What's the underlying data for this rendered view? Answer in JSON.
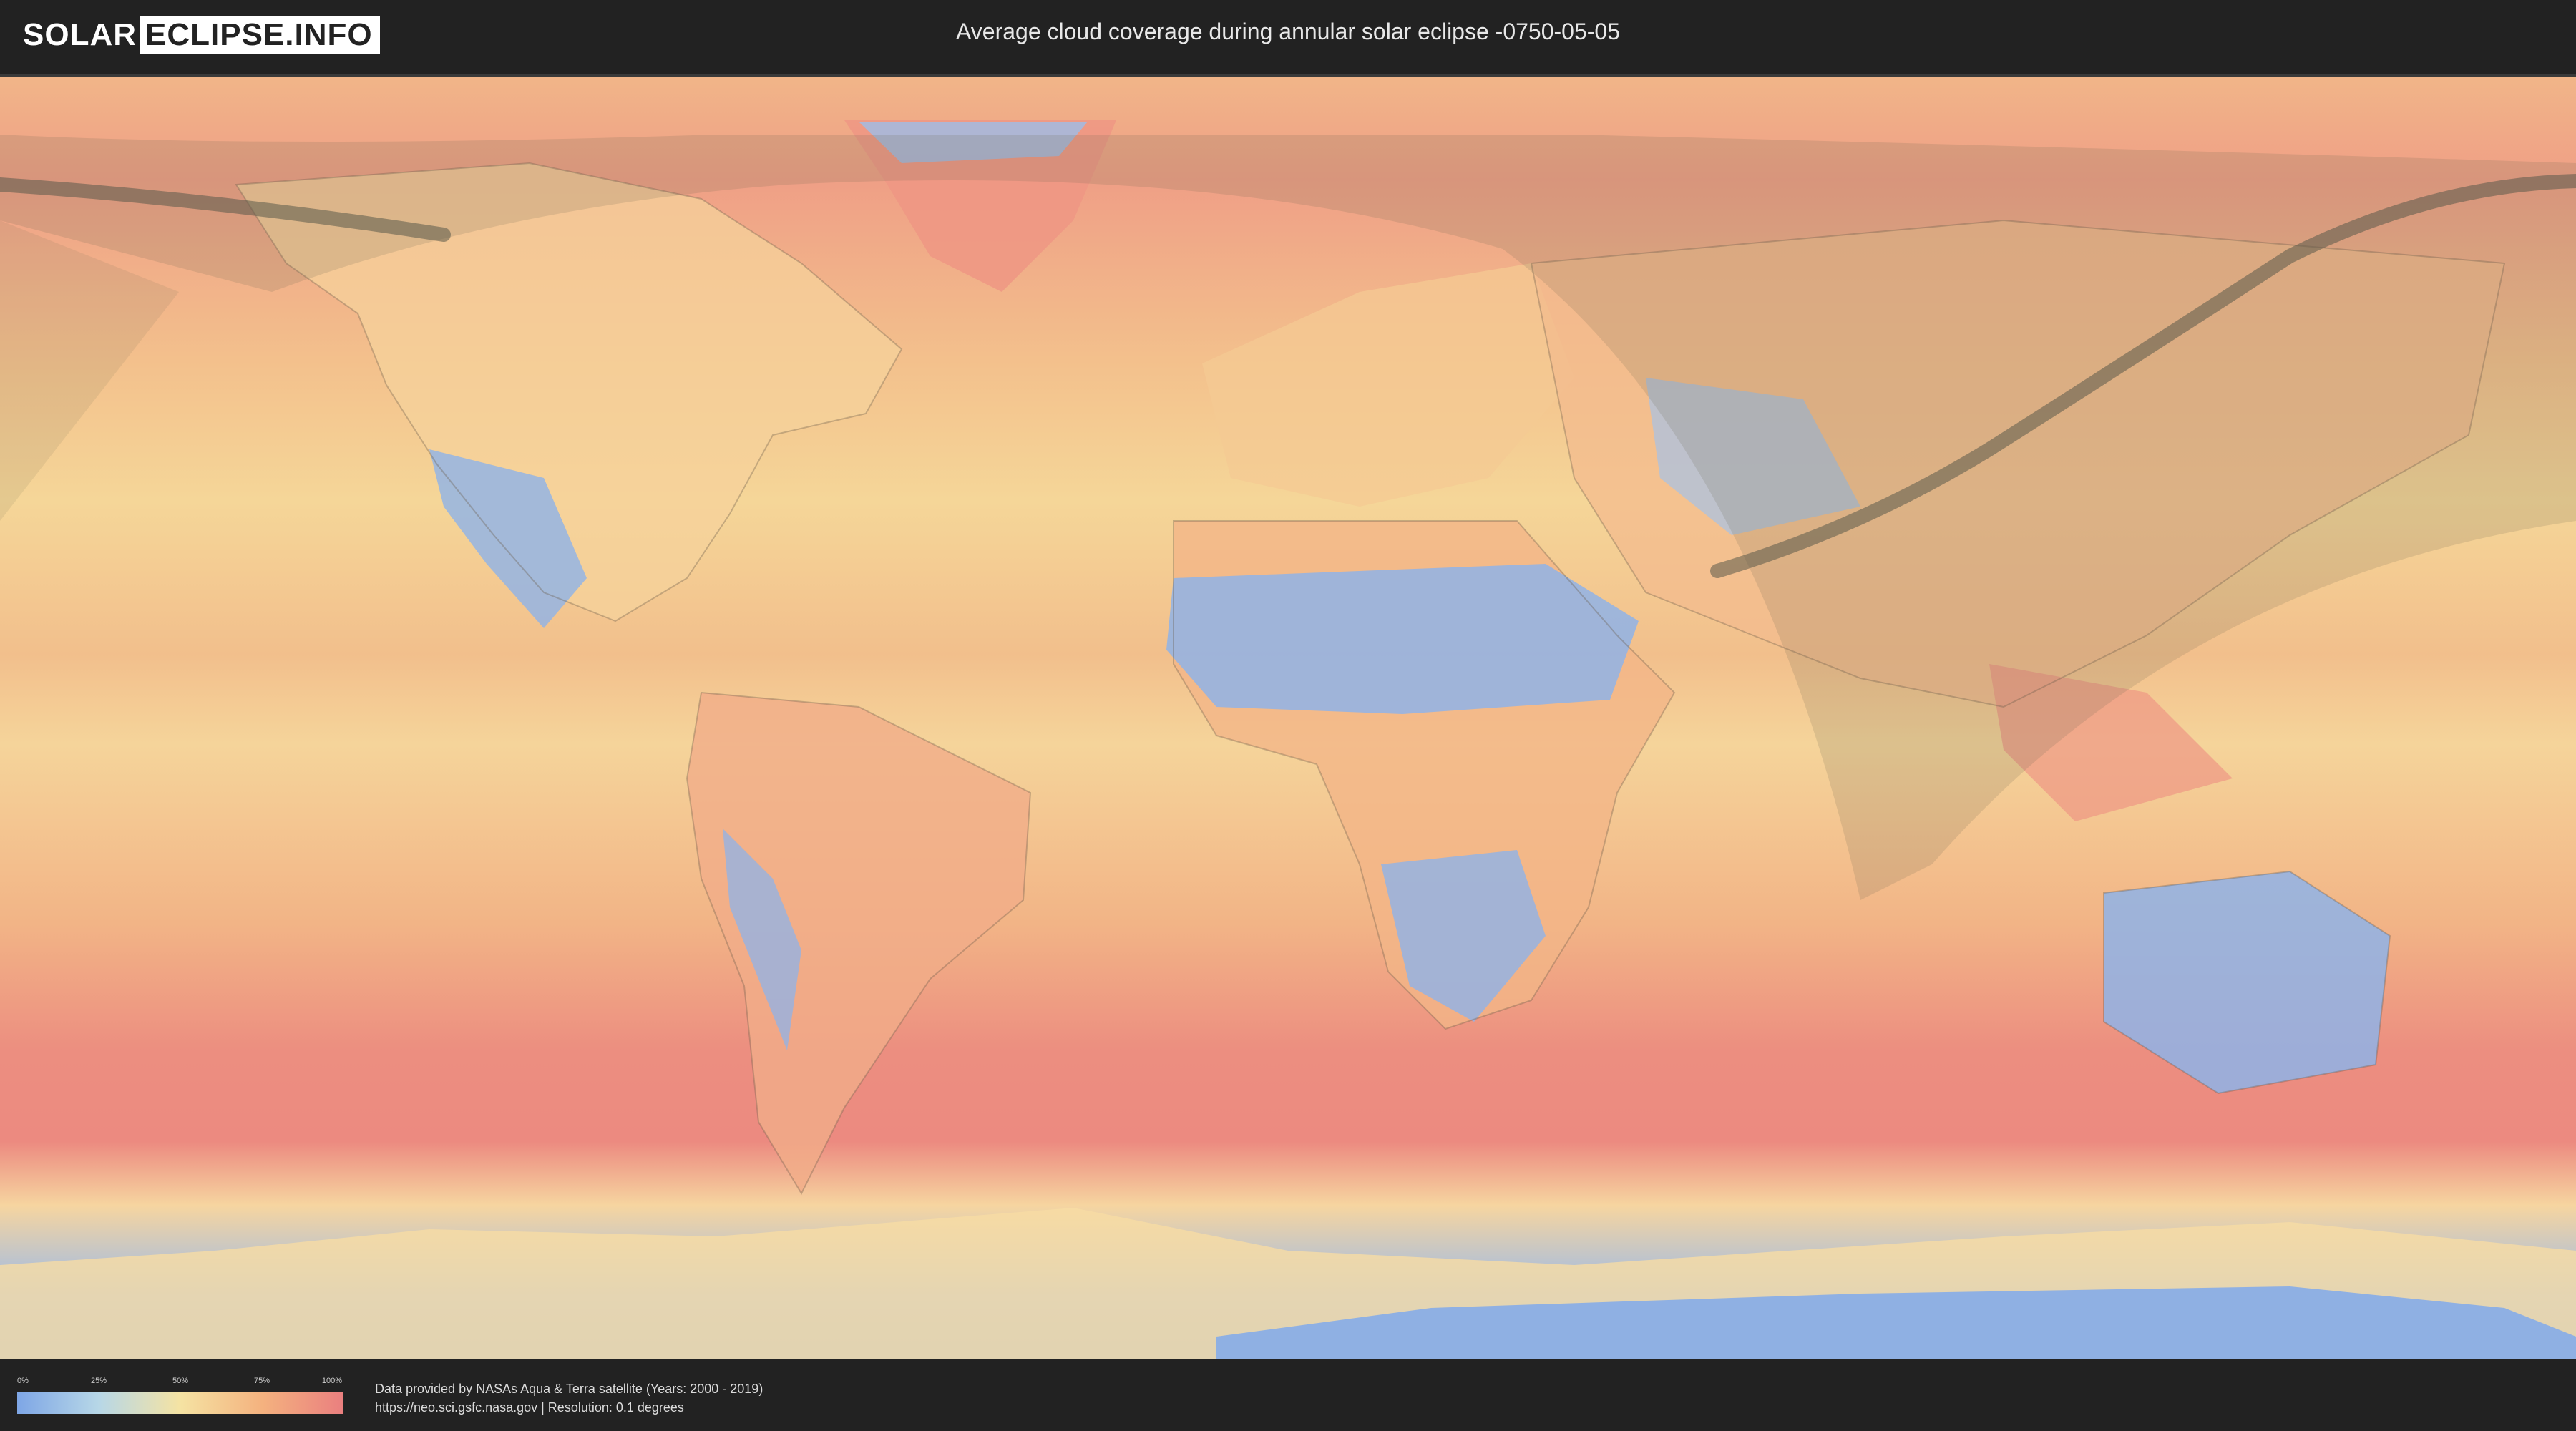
{
  "header": {
    "logo_left": "SOLAR",
    "logo_right": "ECLIPSE.INFO",
    "title": "Average cloud coverage during annular solar eclipse -0750-05-05"
  },
  "legend": {
    "ticks": [
      "0%",
      "25%",
      "50%",
      "75%",
      "100%"
    ],
    "colors": [
      "#7ea6e6",
      "#b7d7e7",
      "#f5e3a3",
      "#f4b27f",
      "#ea7f7f"
    ]
  },
  "footer": {
    "credit_line1": "Data provided by NASAs Aqua & Terra satellite (Years: 2000 - 2019)",
    "credit_line2": "https://neo.sci.gsfc.nasa.gov | Resolution: 0.1 degrees"
  },
  "map": {
    "projection": "equirectangular",
    "ocean_color": "#f3c489",
    "low_cloud_color": "#8fb3e8",
    "high_cloud_color": "#ec8a80",
    "eclipse_path_color": "#5a5a4a"
  }
}
